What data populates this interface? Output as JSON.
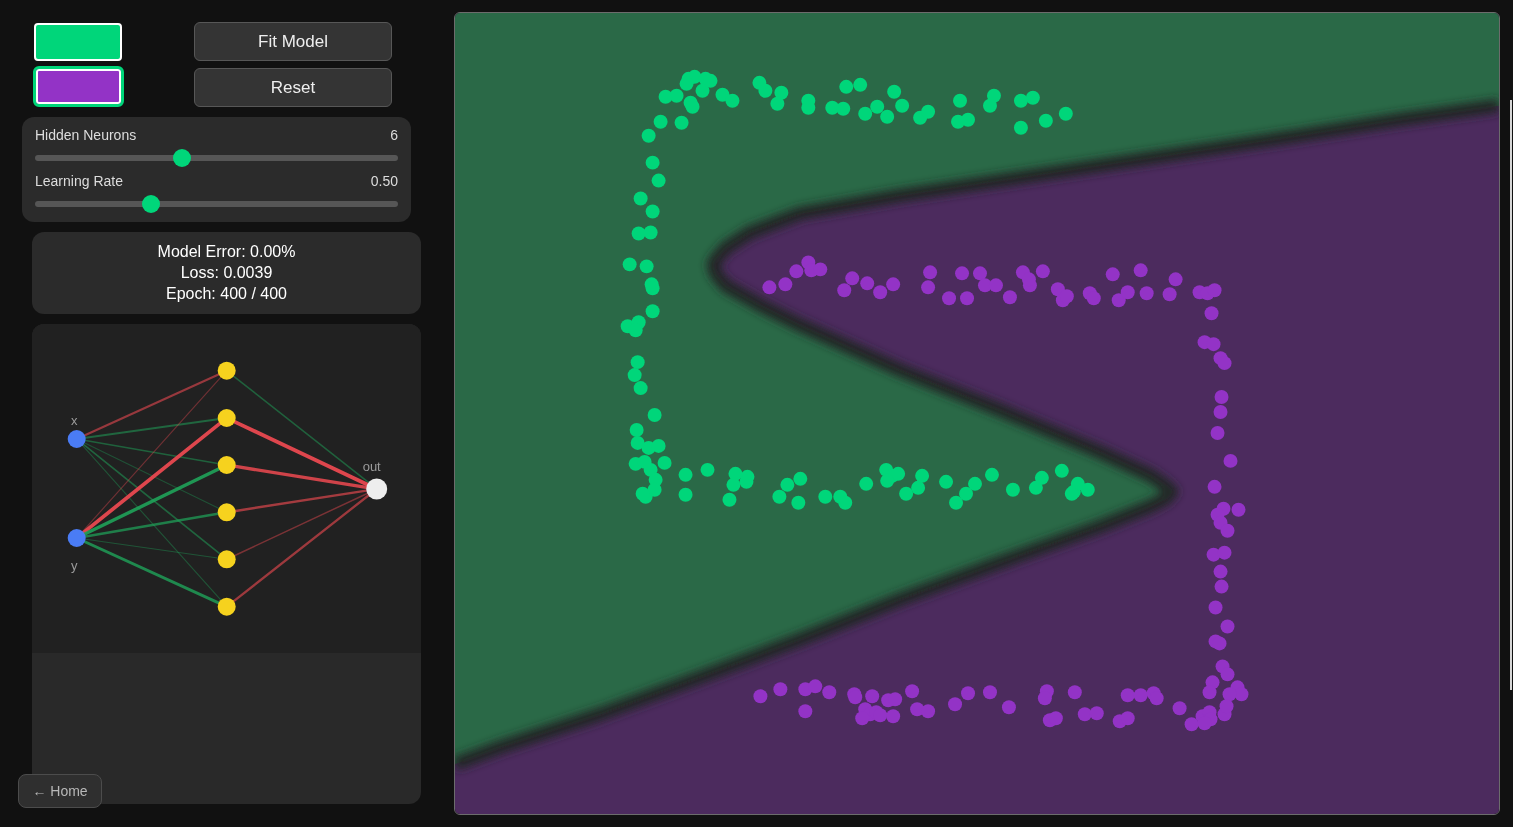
{
  "classes": [
    {
      "color": "#00d67a",
      "selected": false
    },
    {
      "color": "#9333c6",
      "selected": true
    }
  ],
  "buttons": [
    {
      "label": "Fit Model"
    },
    {
      "label": "Reset"
    }
  ],
  "sliders": [
    {
      "label": "Hidden Neurons",
      "value": "6",
      "level": 0.4
    },
    {
      "label": "Learning Rate",
      "value": "0.50",
      "level": 0.31
    }
  ],
  "stats": [
    "Model Error: 0.00%",
    "Loss: 0.0039",
    "Epoch: 400 / 400"
  ],
  "network": {
    "inputs": [
      "x",
      "y"
    ],
    "output": "out"
  },
  "home_button": {
    "label": "← Home"
  }
}
